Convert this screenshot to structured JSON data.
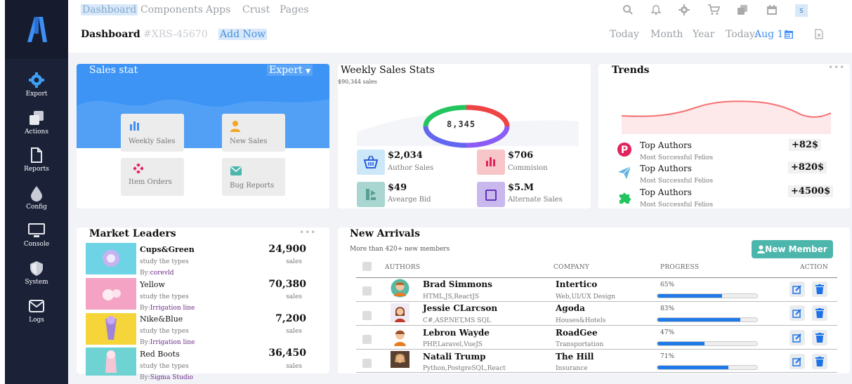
{
  "nav": {
    "items": [
      "Dashboard",
      "Components",
      "Apps",
      "Crust",
      "Pages"
    ],
    "active": "Dashboard",
    "user_initial": "s"
  },
  "subbar": {
    "title": "Dashboard",
    "ref": "#XRS-45670",
    "add_label": "Add Now",
    "periods": [
      "Today",
      "Month",
      "Year"
    ],
    "today_label": "Today:",
    "today_date": "Aug 11"
  },
  "sidebar": {
    "items": [
      {
        "label": "Export",
        "icon": "gear-icon"
      },
      {
        "label": "Actions",
        "icon": "copy-icon"
      },
      {
        "label": "Reports",
        "icon": "file-icon"
      },
      {
        "label": "Config",
        "icon": "drop-icon"
      },
      {
        "label": "Console",
        "icon": "monitor-icon"
      },
      {
        "label": "System",
        "icon": "shield-icon"
      },
      {
        "label": "Logs",
        "icon": "mail-icon"
      }
    ]
  },
  "sales_stat": {
    "title": "Sales stat",
    "dropdown": "Expert",
    "tiles": [
      {
        "label": "Weekly Sales",
        "icon": "bar-chart-icon",
        "color": "#3d8ff5"
      },
      {
        "label": "New Sales",
        "icon": "user-icon",
        "color": "#f5a623"
      },
      {
        "label": "Item Orders",
        "icon": "diamond-icon",
        "color": "#e0245e"
      },
      {
        "label": "Bug Reports",
        "icon": "envelope-icon",
        "color": "#4db6ac"
      }
    ]
  },
  "weekly": {
    "title": "Weekly Sales Stats",
    "subtitle": "$90,344 sales",
    "donut_value": "8,345",
    "stats": [
      {
        "value": "$2,034",
        "label": "Author Sales",
        "color": "#cce8f8",
        "icon": "basket-icon"
      },
      {
        "value": "$706",
        "label": "Commision",
        "color": "#f8c5c8",
        "icon": "bar-chart-icon"
      },
      {
        "value": "$49",
        "label": "Avearge Bid",
        "color": "#a9d6d0",
        "icon": "chart-icon"
      },
      {
        "value": "$5.M",
        "label": "Alternate Sales",
        "color": "#c9b8ee",
        "icon": "square-icon"
      }
    ]
  },
  "trends": {
    "title": "Trends",
    "items": [
      {
        "name": "Top Authors",
        "sub": "Most Successful Felios",
        "value": "+82$",
        "icon": "pinterest-icon",
        "color": "#e0245e"
      },
      {
        "name": "Top Authors",
        "sub": "Most Successful Felios",
        "value": "+820$",
        "icon": "paper-plane-icon",
        "color": "#5fb3e0"
      },
      {
        "name": "Top Authors",
        "sub": "Most Successful Felios",
        "value": "+4500$",
        "icon": "puzzle-icon",
        "color": "#22c55e"
      }
    ]
  },
  "market": {
    "title": "Market Leaders",
    "items": [
      {
        "name": "Cups&Green",
        "bold": true,
        "sub": "study the types",
        "by": "By:",
        "author": "corevld",
        "value": "24,900",
        "unit": "sales",
        "img_color": "#6fd3e6"
      },
      {
        "name": "Yellow",
        "bold": false,
        "sub": "study the types",
        "by": "By:",
        "author": "Irrigation line",
        "value": "70,380",
        "unit": "sales",
        "img_color": "#f4a3c4"
      },
      {
        "name": "Nike&Blue",
        "bold": false,
        "sub": "study the types",
        "by": "By:",
        "author": "Irrigation line",
        "value": "7,200",
        "unit": "sales",
        "img_color": "#f5d53a"
      },
      {
        "name": "Red Boots",
        "bold": false,
        "sub": "study the types",
        "by": "By:",
        "author": "Sigma Studio",
        "value": "36,450",
        "unit": "sales",
        "img_color": "#6fd3d3"
      }
    ]
  },
  "arrivals": {
    "title": "New Arrivals",
    "subtitle": "More than 420+ new members",
    "new_member": "New Member",
    "headers": [
      "AUTHORS",
      "COMPANY",
      "PROGRESS",
      "ACTION"
    ],
    "rows": [
      {
        "name": "Brad Simmons",
        "skills": "HTML,JS,ReactJS",
        "company": "Intertico",
        "sector": "Web,UI/UX Design",
        "progress_label": "65%",
        "progress": 0.65,
        "avatar_color": "#5bb8a5"
      },
      {
        "name": "Jessie CLarcson",
        "skills": "C#,ASP.NET,MS SQL",
        "company": "Agoda",
        "sector": "Houses&Hotels",
        "progress_label": "83%",
        "progress": 0.83,
        "avatar_color": "#c0392b"
      },
      {
        "name": "Lebron Wayde",
        "skills": "PHP,Laravel,VueJS",
        "company": "RoadGee",
        "sector": "Transportation",
        "progress_label": "47%",
        "progress": 0.47,
        "avatar_color": "#e67e22"
      },
      {
        "name": "Natali Trump",
        "skills": "Python,PostgreSQL,React",
        "company": "The Hill",
        "sector": "Insurance",
        "progress_label": "71%",
        "progress": 0.71,
        "avatar_color": "#7a5a3a"
      }
    ]
  }
}
